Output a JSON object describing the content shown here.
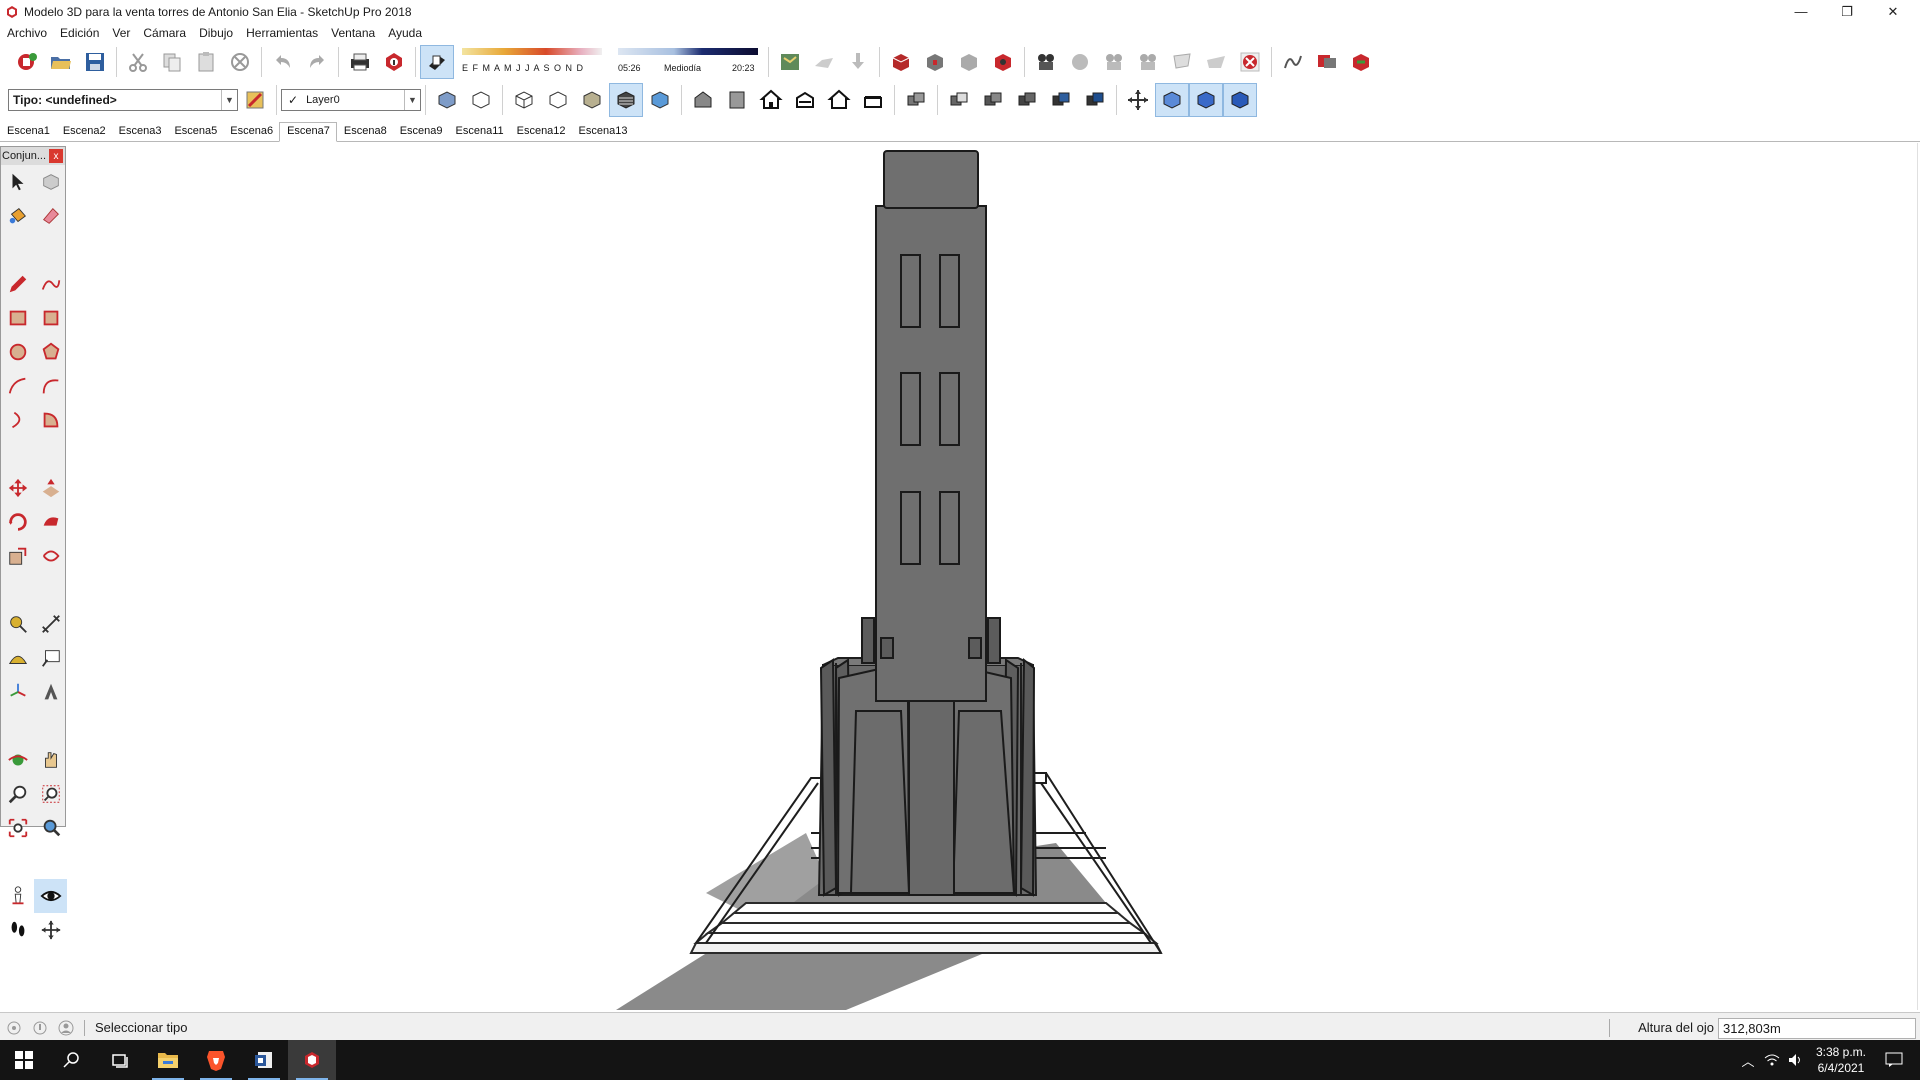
{
  "window": {
    "title": "Modelo 3D para la venta torres de Antonio San Elia - SketchUp Pro 2018",
    "minimize": "—",
    "restore": "❐",
    "close": "✕"
  },
  "menu": [
    "Archivo",
    "Edición",
    "Ver",
    "Cámara",
    "Dibujo",
    "Herramientas",
    "Ventana",
    "Ayuda"
  ],
  "shadow_panel": {
    "months": "E F M A M J J A S O N D",
    "time_start": "05:26",
    "time_mid": "Mediodía",
    "time_end": "20:23"
  },
  "style_select": {
    "value": "Tipo: <undefined>"
  },
  "layer_select": {
    "check": "✓",
    "value": "Layer0"
  },
  "scenes": [
    "Escena1",
    "Escena2",
    "Escena3",
    "Escena5",
    "Escena6",
    "Escena7",
    "Escena8",
    "Escena9",
    "Escena11",
    "Escena12",
    "Escena13"
  ],
  "active_scene": "Escena7",
  "palette": {
    "title": "Conjun...",
    "close": "x"
  },
  "status": {
    "hint": "Seleccionar tipo",
    "measure_label": "Altura del ojo",
    "measure_value": "312,803m"
  },
  "taskbar": {
    "time": "3:38 p.m.",
    "date": "6/4/2021"
  },
  "colors": {
    "accent_red": "#c8282d",
    "model_gray": "#6f6f6f",
    "shadow_gray": "#8a8a8a",
    "taskbar": "#141414"
  }
}
